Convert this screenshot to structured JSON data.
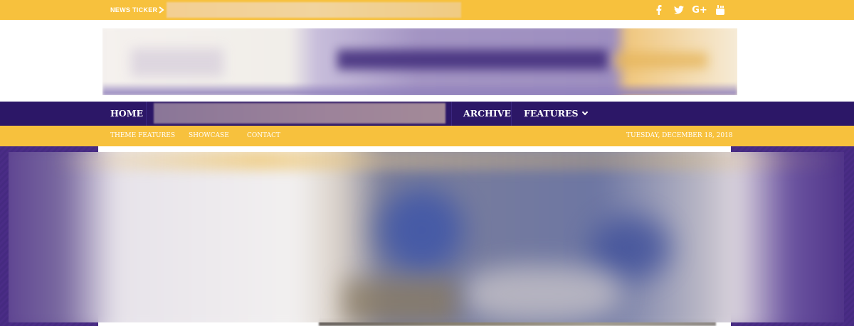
{
  "ticker": {
    "label": "NEWS TICKER"
  },
  "social": {
    "facebook": "f",
    "twitter": "𝐭",
    "google": "G+",
    "youtube": "▶"
  },
  "nav": {
    "home": "HOME",
    "archive": "ARCHIVE",
    "features": "FEATURES"
  },
  "subnav": {
    "theme_features": "THEME FEATURES",
    "showcase": "SHOWCASE",
    "contact": "CONTACT",
    "date": "TUESDAY, DECEMBER 18, 2018"
  },
  "colors": {
    "gold": "#f7c13d",
    "purple": "#2c1767",
    "purple_bg": "#4a2d84"
  },
  "icons": [
    "chevron-right-icon",
    "facebook-icon",
    "twitter-icon",
    "google-plus-icon",
    "youtube-icon",
    "chevron-down-icon"
  ]
}
